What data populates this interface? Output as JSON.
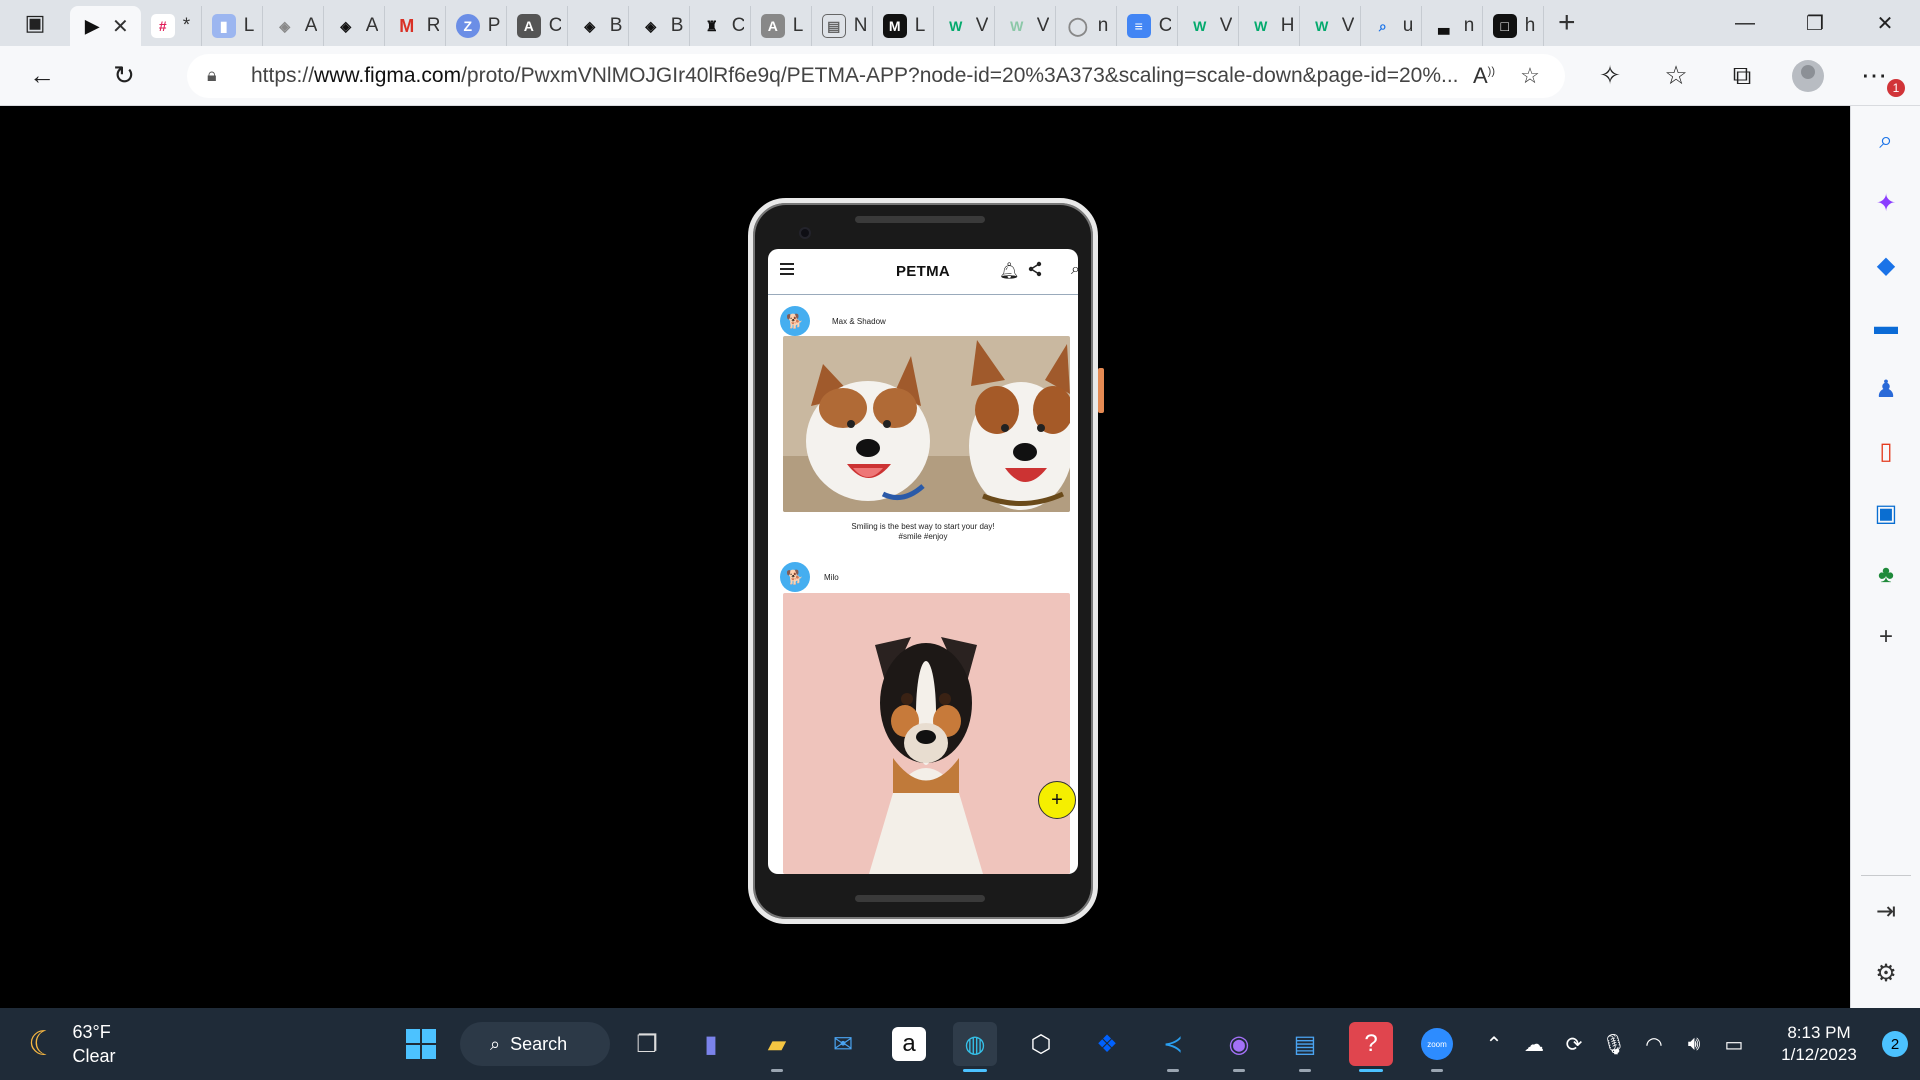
{
  "browser": {
    "tabs": [
      {
        "icon": "figma-play-icon",
        "letter": "",
        "active": true
      },
      {
        "icon": "slack-icon",
        "letter": "*"
      },
      {
        "icon": "zoom-video-icon",
        "letter": "L"
      },
      {
        "icon": "codepen-icon",
        "letter": "A"
      },
      {
        "icon": "codepen-icon",
        "letter": "A"
      },
      {
        "icon": "gmail-icon",
        "letter": "R"
      },
      {
        "icon": "z-icon",
        "letter": "P"
      },
      {
        "icon": "hackerrank-icon",
        "letter": "C"
      },
      {
        "icon": "codepen-icon",
        "letter": "B"
      },
      {
        "icon": "codepen-icon",
        "letter": "B"
      },
      {
        "icon": "trophy-icon",
        "letter": "C"
      },
      {
        "icon": "hackerrank-icon",
        "letter": "L"
      },
      {
        "icon": "calendar-icon",
        "letter": "N"
      },
      {
        "icon": "m-icon",
        "letter": "L"
      },
      {
        "icon": "w3-icon",
        "letter": "V"
      },
      {
        "icon": "w3-icon",
        "letter": "V"
      },
      {
        "icon": "github-icon",
        "letter": "n"
      },
      {
        "icon": "docs-icon",
        "letter": "C"
      },
      {
        "icon": "w3-icon",
        "letter": "V"
      },
      {
        "icon": "w3-icon",
        "letter": "H"
      },
      {
        "icon": "w3-icon",
        "letter": "V"
      },
      {
        "icon": "search-icon",
        "letter": "u"
      },
      {
        "icon": "unsplash-icon",
        "letter": "n"
      },
      {
        "icon": "square-icon",
        "letter": "h"
      }
    ],
    "url_prefix": "https://",
    "url_domain": "www.figma.com",
    "url_rest": "/proto/PwxmVNlMOJGIr40lRf6e9q/PETMA-APP?node-id=20%3A373&scaling=scale-down&page-id=20%...",
    "notification_badge": "1"
  },
  "app": {
    "title": "PETMA",
    "posts": [
      {
        "pet_name": "Max & Shadow",
        "caption_line1": "Smiling is the best way to start your day!",
        "caption_line2": "#smile #enjoy"
      },
      {
        "pet_name": "Milo"
      }
    ],
    "fab_label": "+"
  },
  "taskbar": {
    "weather_temp": "63°F",
    "weather_desc": "Clear",
    "search_label": "Search",
    "time": "8:13 PM",
    "date": "1/12/2023",
    "notification_count": "2"
  },
  "colors": {
    "fab": "#f5ef00",
    "avatar_blue": "#45aef0",
    "taskbar": "#1f2b38",
    "accent": "#4cc2ff"
  }
}
